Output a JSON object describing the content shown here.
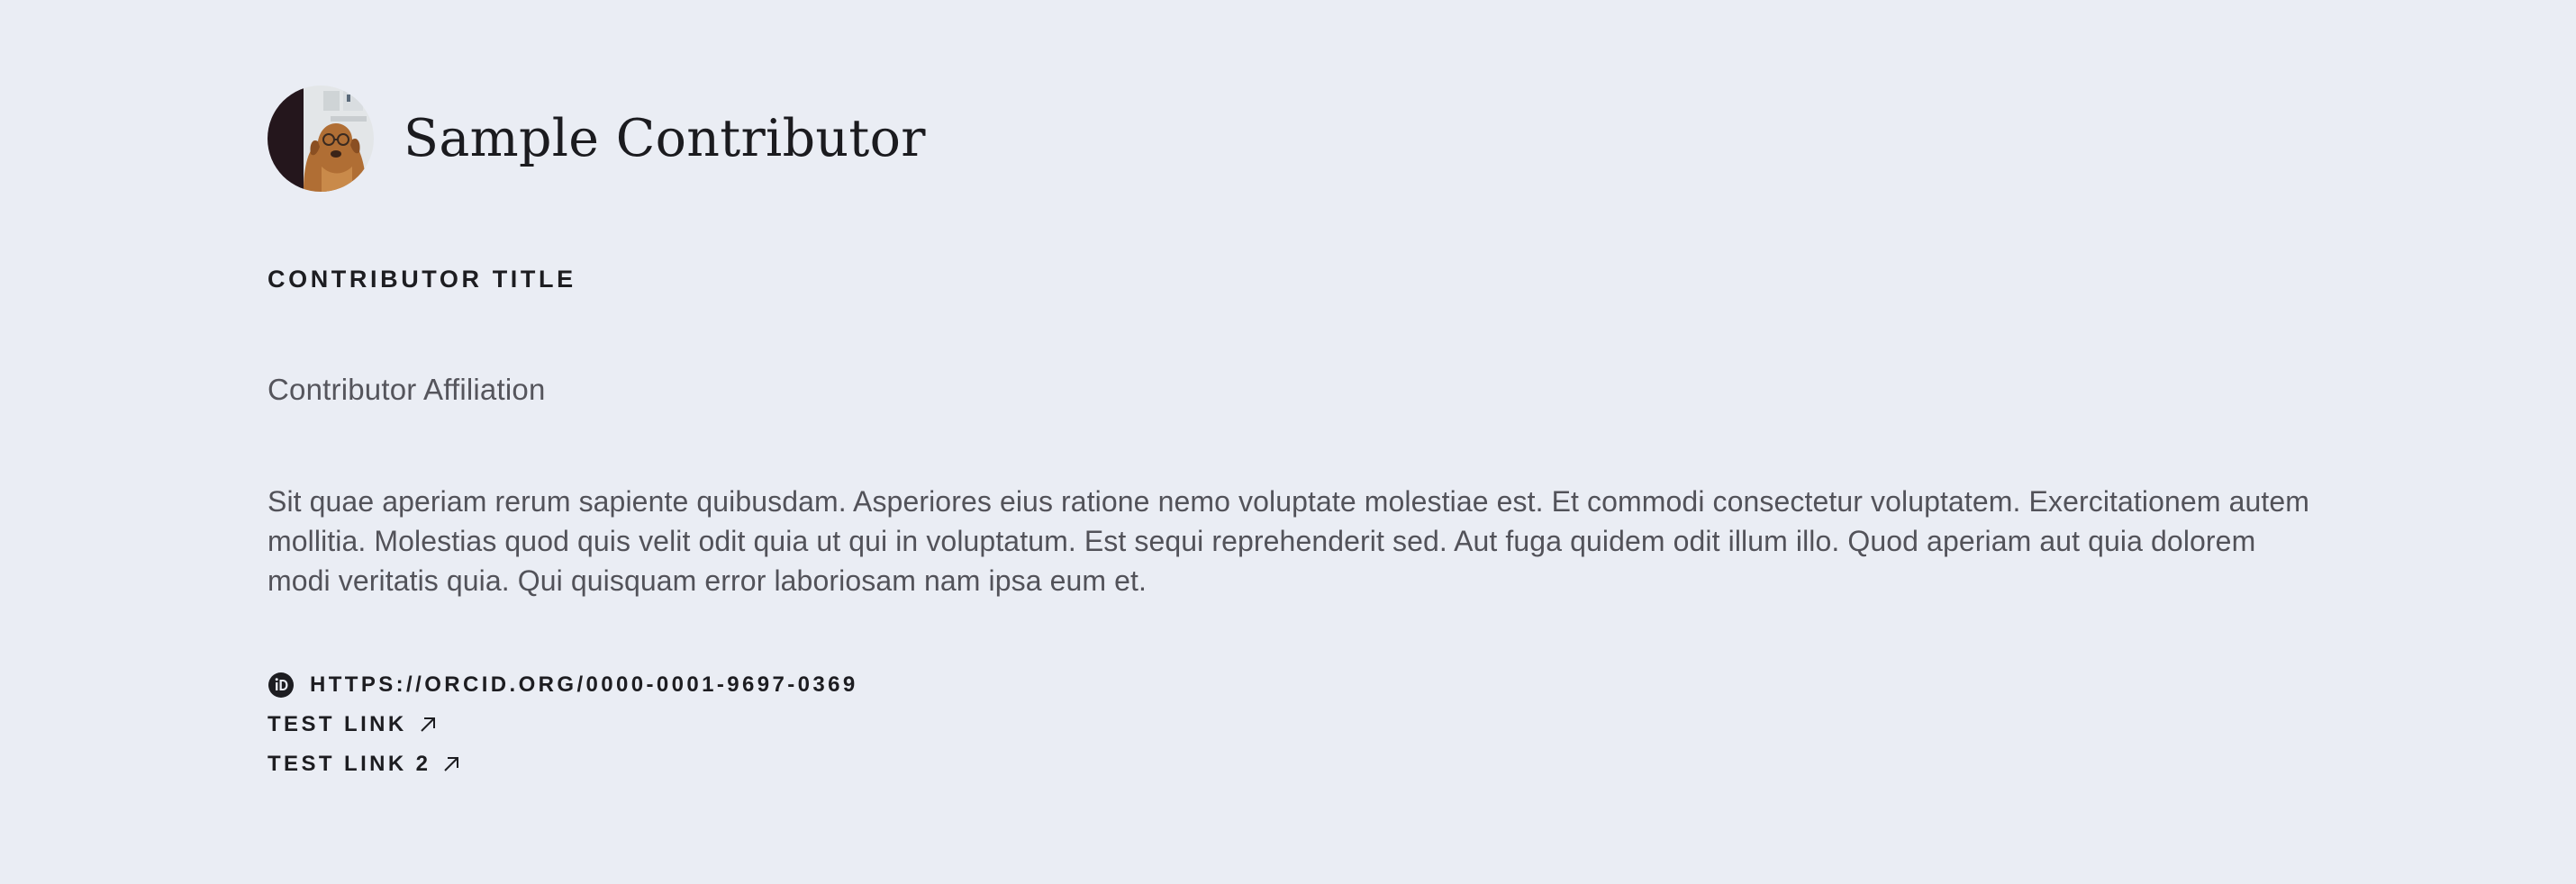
{
  "contributor": {
    "name": "Sample Contributor",
    "avatar_icon": "avatar-photo-dog-icon",
    "title": "CONTRIBUTOR TITLE",
    "affiliation": "Contributor Affiliation",
    "bio": "Sit quae aperiam rerum sapiente quibusdam. Asperiores eius ratione nemo voluptate molestiae est. Et commodi consectetur voluptatem. Exercitationem autem mollitia. Molestias quod quis velit odit quia ut qui in voluptatum. Est sequi reprehenderit sed. Aut fuga quidem odit illum illo. Quod aperiam aut quia dolorem modi veritatis quia. Qui quisquam error laboriosam nam ipsa eum et."
  },
  "links": {
    "orcid": {
      "icon": "orcid-icon",
      "label": "HTTPS://ORCID.ORG/0000-0001-9697-0369"
    },
    "external": [
      {
        "label": "TEST LINK",
        "icon": "external-arrow-icon"
      },
      {
        "label": "TEST LINK 2",
        "icon": "external-arrow-icon"
      }
    ]
  },
  "colors": {
    "background": "#eaedf4",
    "text_primary": "#1d1d21",
    "text_secondary": "#55555c"
  }
}
